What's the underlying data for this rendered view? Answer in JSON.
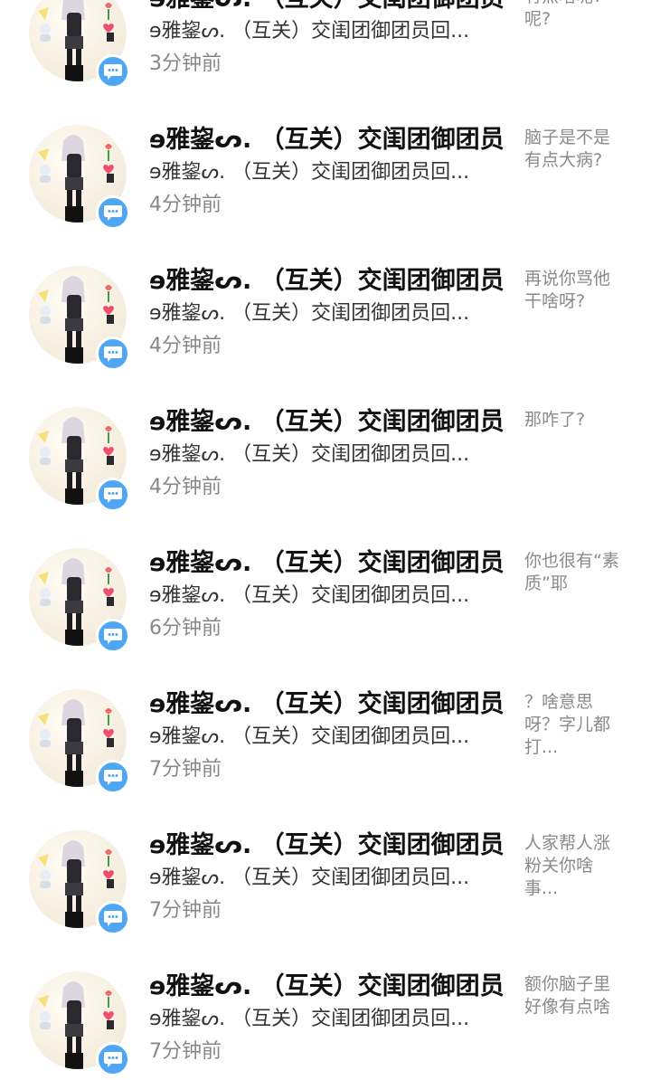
{
  "notifications": [
    {
      "name": "ɘ雅鋆ᔕ. （互关）交闺团御团员",
      "subtitle": "ɘ雅鋆ᔕ. （互关）交闺团御团员回...",
      "time": "3分钟前",
      "message": "有点啥呢? 呢?"
    },
    {
      "name": "ɘ雅鋆ᔕ. （互关）交闺团御团员",
      "subtitle": "ɘ雅鋆ᔕ. （互关）交闺团御团员回...",
      "time": "4分钟前",
      "message": "脑子是不是有点大病?"
    },
    {
      "name": "ɘ雅鋆ᔕ. （互关）交闺团御团员",
      "subtitle": "ɘ雅鋆ᔕ. （互关）交闺团御团员回...",
      "time": "4分钟前",
      "message": "再说你骂他干啥呀?"
    },
    {
      "name": "ɘ雅鋆ᔕ. （互关）交闺团御团员",
      "subtitle": "ɘ雅鋆ᔕ. （互关）交闺团御团员回...",
      "time": "4分钟前",
      "message": "那咋了?"
    },
    {
      "name": "ɘ雅鋆ᔕ. （互关）交闺团御团员",
      "subtitle": "ɘ雅鋆ᔕ. （互关）交闺团御团员回...",
      "time": "6分钟前",
      "message": "你也很有“素质”耶"
    },
    {
      "name": "ɘ雅鋆ᔕ. （互关）交闺团御团员",
      "subtitle": "ɘ雅鋆ᔕ. （互关）交闺团御团员回...",
      "time": "7分钟前",
      "message": "？啥意思呀？字儿都打..."
    },
    {
      "name": "ɘ雅鋆ᔕ. （互关）交闺团御团员",
      "subtitle": "ɘ雅鋆ᔕ. （互关）交闺团御团员回...",
      "time": "7分钟前",
      "message": "人家帮人涨粉关你啥事..."
    },
    {
      "name": "ɘ雅鋆ᔕ. （互关）交闺团御团员",
      "subtitle": "ɘ雅鋆ᔕ. （互关）交闺团御团员回...",
      "time": "7分钟前",
      "message": "额你脑子里好像有点啥"
    }
  ],
  "colors": {
    "badge": "#4fa6f5",
    "time": "#888888",
    "message": "#8a8a8a"
  },
  "icons": {
    "badge": "chat-bubble-icon"
  }
}
